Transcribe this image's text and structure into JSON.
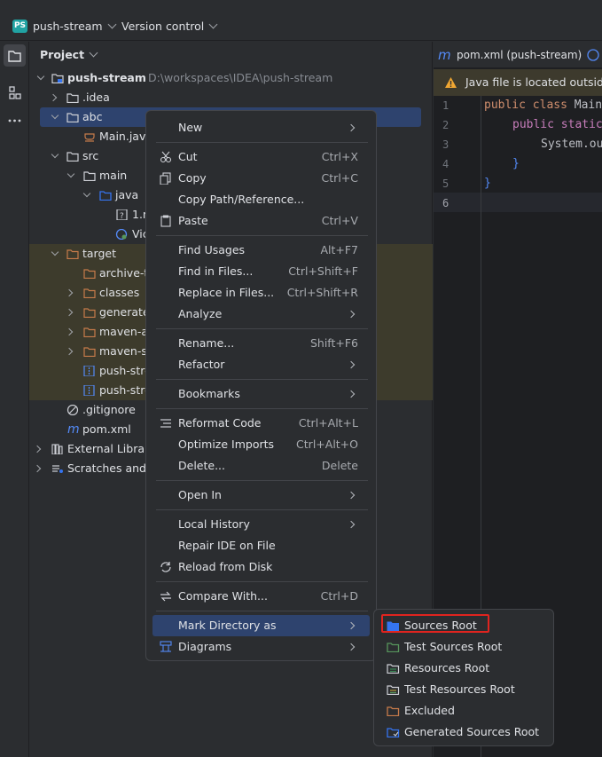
{
  "titlebar": {
    "project_name": "push-stream",
    "project_badge": "PS",
    "vcs_label": "Version control"
  },
  "project_pane": {
    "header": "Project",
    "tree": [
      {
        "label": "push-stream",
        "path": "D:\\workspaces\\IDEA\\push-stream",
        "icon": "module-folder-icon"
      },
      {
        "label": ".idea",
        "icon": "folder-icon"
      },
      {
        "label": "abc",
        "icon": "folder-icon"
      },
      {
        "label": "Main.java",
        "icon": "java-file-icon"
      },
      {
        "label": "src",
        "icon": "folder-icon"
      },
      {
        "label": "main",
        "icon": "folder-icon"
      },
      {
        "label": "java",
        "icon": "source-folder-icon"
      },
      {
        "label": "1.n",
        "icon": "unknown-file-icon"
      },
      {
        "label": "Vic",
        "icon": "java-class-icon"
      },
      {
        "label": "target",
        "icon": "excluded-folder-icon"
      },
      {
        "label": "archive-t",
        "icon": "excluded-folder-icon"
      },
      {
        "label": "classes",
        "icon": "excluded-folder-icon"
      },
      {
        "label": "generate",
        "icon": "excluded-folder-icon"
      },
      {
        "label": "maven-ar",
        "icon": "excluded-folder-icon"
      },
      {
        "label": "maven-st",
        "icon": "excluded-folder-icon"
      },
      {
        "label": "push-stre",
        "icon": "archive-file-icon"
      },
      {
        "label": "push-stre",
        "icon": "archive-file-icon"
      },
      {
        "label": ".gitignore",
        "icon": "ignore-file-icon"
      },
      {
        "label": "pom.xml",
        "icon": "maven-file-icon"
      },
      {
        "label": "External Librari",
        "icon": "library-icon"
      },
      {
        "label": "Scratches and C",
        "icon": "scratches-icon"
      }
    ]
  },
  "editor": {
    "tab_label": "pom.xml (push-stream)",
    "banner": "Java file is located outside",
    "line_numbers": [
      "1",
      "2",
      "3",
      "4",
      "5",
      "6"
    ],
    "code": {
      "l1_kw1": "public",
      "l1_kw2": "class",
      "l1_name": "Main",
      "l2_kw1": "public",
      "l2_kw2": "static",
      "l3": "System.ou",
      "l4": "}",
      "l5": "}"
    }
  },
  "context_menu": {
    "items": [
      {
        "label": "New",
        "shortcut": "",
        "submenu": true
      },
      {
        "label": "Cut",
        "shortcut": "Ctrl+X"
      },
      {
        "label": "Copy",
        "shortcut": "Ctrl+C"
      },
      {
        "label": "Copy Path/Reference...",
        "shortcut": ""
      },
      {
        "label": "Paste",
        "shortcut": "Ctrl+V"
      },
      {
        "label": "Find Usages",
        "shortcut": "Alt+F7"
      },
      {
        "label": "Find in Files...",
        "shortcut": "Ctrl+Shift+F"
      },
      {
        "label": "Replace in Files...",
        "shortcut": "Ctrl+Shift+R"
      },
      {
        "label": "Analyze",
        "shortcut": "",
        "submenu": true
      },
      {
        "label": "Rename...",
        "shortcut": "Shift+F6"
      },
      {
        "label": "Refactor",
        "shortcut": "",
        "submenu": true
      },
      {
        "label": "Bookmarks",
        "shortcut": "",
        "submenu": true
      },
      {
        "label": "Reformat Code",
        "shortcut": "Ctrl+Alt+L"
      },
      {
        "label": "Optimize Imports",
        "shortcut": "Ctrl+Alt+O"
      },
      {
        "label": "Delete...",
        "shortcut": "Delete"
      },
      {
        "label": "Open In",
        "shortcut": "",
        "submenu": true
      },
      {
        "label": "Local History",
        "shortcut": "",
        "submenu": true
      },
      {
        "label": "Repair IDE on File",
        "shortcut": ""
      },
      {
        "label": "Reload from Disk",
        "shortcut": ""
      },
      {
        "label": "Compare With...",
        "shortcut": "Ctrl+D"
      },
      {
        "label": "Mark Directory as",
        "shortcut": "",
        "submenu": true
      },
      {
        "label": "Diagrams",
        "shortcut": "",
        "submenu": true
      }
    ]
  },
  "mark_directory_submenu": {
    "items": [
      {
        "label": "Sources Root",
        "color": "#3574f0"
      },
      {
        "label": "Test Sources Root",
        "color": "#57965c"
      },
      {
        "label": "Resources Root",
        "color": "#3b8a55"
      },
      {
        "label": "Test Resources Root",
        "color": "#b59a3a"
      },
      {
        "label": "Excluded",
        "color": "#c77b4a"
      },
      {
        "label": "Generated Sources Root",
        "color": "#3574f0"
      }
    ]
  },
  "colors": {
    "accent": "#3574f0",
    "selection": "#2e436e",
    "highlight_box": "#e0241f"
  }
}
